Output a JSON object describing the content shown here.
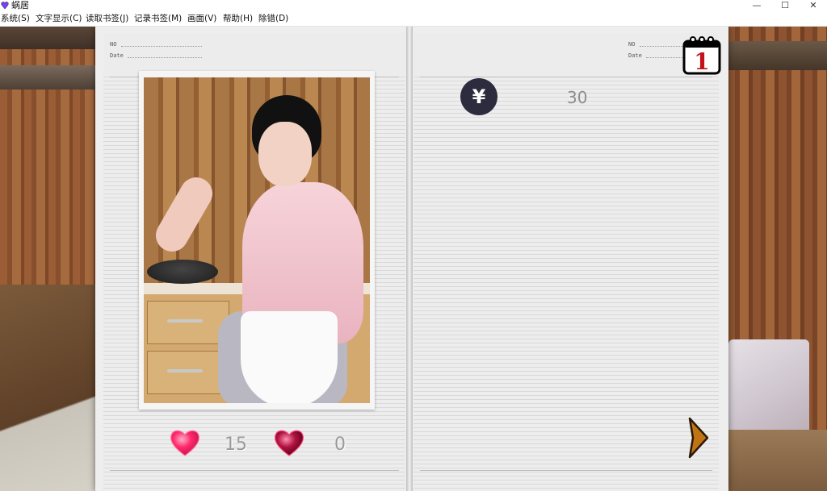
{
  "window": {
    "title": "蜗居",
    "minimize": "—",
    "maximize": "☐",
    "close": "✕"
  },
  "menu": [
    {
      "label": "系统(S)"
    },
    {
      "label": "文字显示(C)"
    },
    {
      "label": "读取书签(J)"
    },
    {
      "label": "记录书签(M)"
    },
    {
      "label": "画面(V)"
    },
    {
      "label": "帮助(H)"
    },
    {
      "label": "除错(D)"
    }
  ],
  "notebook": {
    "no_label": "NO",
    "date_label": "Date"
  },
  "stats": {
    "affection": "15",
    "lust": "0"
  },
  "money": {
    "symbol": "¥",
    "amount": "30"
  },
  "calendar": {
    "day": "1"
  },
  "colors": {
    "heart_pink": "#ff2a6d",
    "heart_dark": "#b0123f",
    "arrow": "#b86a12",
    "yen_bg": "#2c2c3e"
  },
  "icons": {
    "affection": "heart-icon",
    "lust": "heart-dark-icon",
    "money": "yen-icon",
    "calendar": "calendar-icon",
    "next": "chevron-right-icon"
  }
}
